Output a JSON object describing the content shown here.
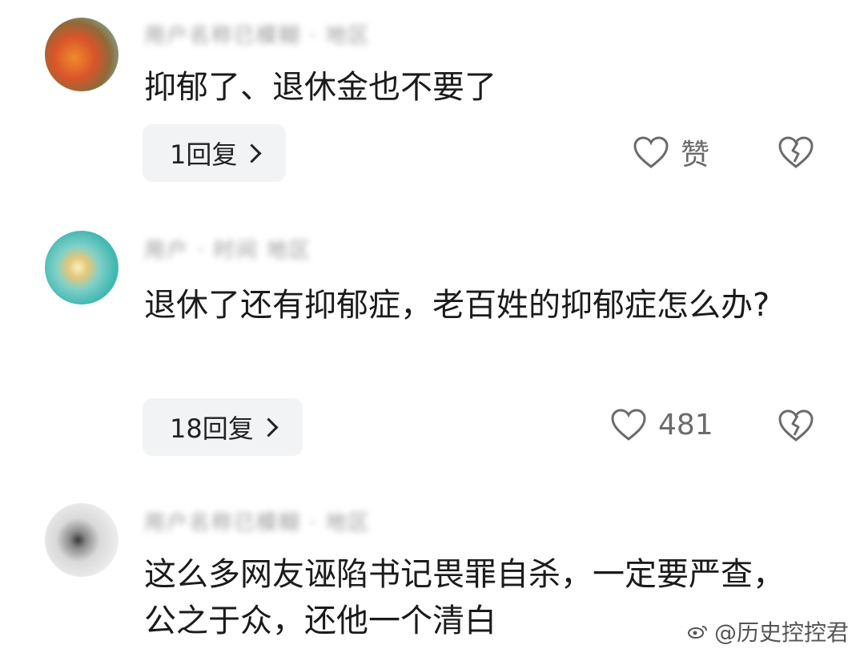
{
  "comments": [
    {
      "username": "用户名称已模糊 · 地区",
      "text": "抑郁了、退休金也不要了",
      "reply_label": "1回复",
      "like_label": "赞"
    },
    {
      "username": "用户 · 时间 地区",
      "text": "退休了还有抑郁症，老百姓的抑郁症怎么办?",
      "reply_label": "18回复",
      "like_label": "481"
    },
    {
      "username": "用户名称已模糊 · 地区",
      "text": "这么多网友诬陷书记畏罪自杀，一定要严查，公之于众，还他一个清白"
    }
  ],
  "watermark": {
    "text": "@历史控控君"
  },
  "icons": {
    "like": "heart-outline-icon",
    "dislike": "broken-heart-icon",
    "reply_arrow": "chevron-right-icon"
  }
}
